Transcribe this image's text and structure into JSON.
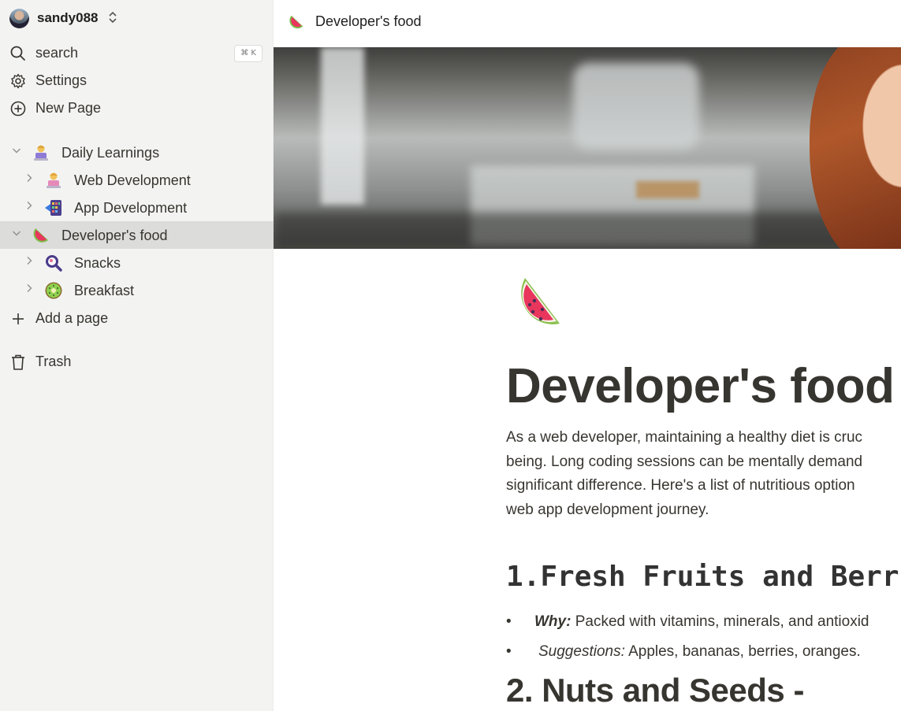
{
  "sidebar": {
    "username": "sandy088",
    "search_label": "search",
    "search_shortcut": "⌘ K",
    "settings_label": "Settings",
    "new_page_label": "New Page",
    "tree": [
      {
        "label": "Daily Learnings",
        "icon": "person-laptop-icon"
      },
      {
        "label": "Web Development",
        "icon": "person-laptop-icon"
      },
      {
        "label": "App Development",
        "icon": "mobile-app-icon"
      },
      {
        "label": "Developer's food",
        "icon": "watermelon-icon"
      },
      {
        "label": "Snacks",
        "icon": "magnifier-icon"
      },
      {
        "label": "Breakfast",
        "icon": "kiwi-icon"
      }
    ],
    "add_page_label": "Add a page",
    "trash_label": "Trash"
  },
  "topbar": {
    "title": "Developer's food"
  },
  "page": {
    "title": "Developer's food",
    "intro_lines": [
      "As a web developer, maintaining a healthy diet is cruc",
      "being. Long coding sessions can be mentally demand",
      "significant difference. Here's a list of nutritious option",
      "web app development journey."
    ],
    "heading1": "1.Fresh Fruits and Berr",
    "bullets": [
      {
        "label": "Why:",
        "text": " Packed with vitamins, minerals, and antioxid"
      },
      {
        "label": "Suggestions:",
        "text": " Apples, bananas, berries, oranges."
      }
    ],
    "heading2": "2. Nuts and Seeds -"
  },
  "colors": {
    "sidebar_bg": "#f3f3f2",
    "active_row": "#dcdcdb",
    "text": "#37352f"
  }
}
